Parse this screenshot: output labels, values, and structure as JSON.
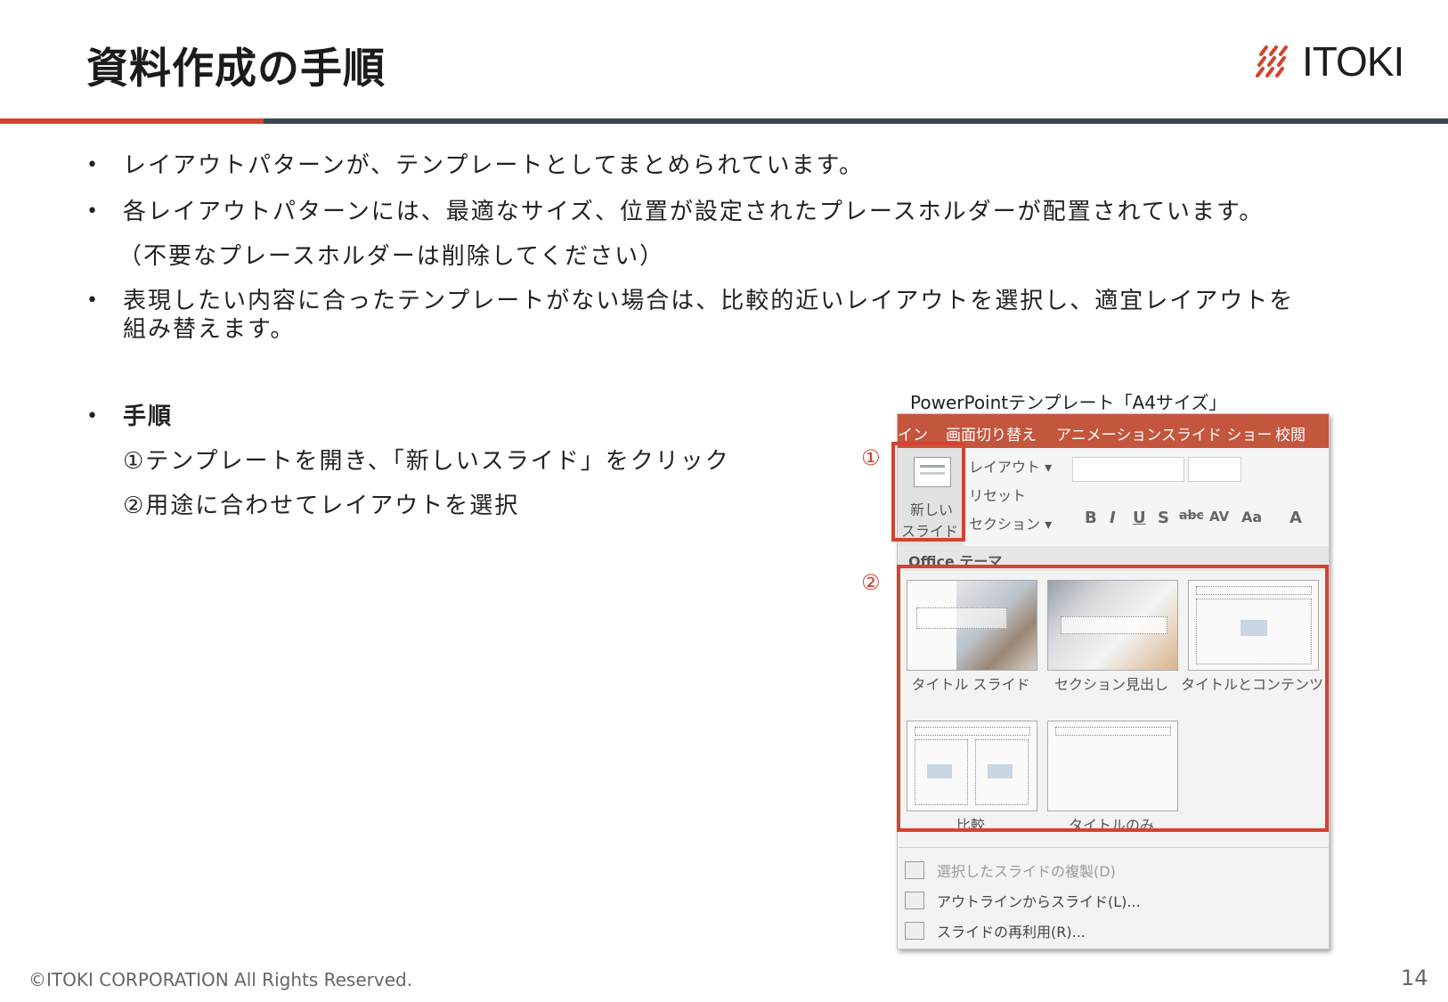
{
  "slide": {
    "title": "資料作成の手順",
    "logo_text": "ITOKI",
    "bullets": [
      "レイアウトパターンが、テンプレートとしてまとめられています。",
      "各レイアウトパターンには、最適なサイズ、位置が設定されたプレースホルダーが配置されています。",
      "表現したい内容に合ったテンプレートがない場合は、比較的近いレイアウトを選択し、適宜レイアウトを組み替えます。"
    ],
    "bullet2_note": "（不要なプレースホルダーは削除してください）",
    "procedure_heading": "手順",
    "steps": [
      "①テンプレートを開き、「新しいスライド」をクリック",
      "②用途に合わせてレイアウトを選択"
    ],
    "footer_copyright": "©ITOKI CORPORATION All Rights Reserved.",
    "page_number": "14"
  },
  "screenshot": {
    "caption": "PowerPointテンプレート「A4サイズ」",
    "markers": [
      "①",
      "②"
    ],
    "tabs": [
      "イン",
      "画面切り替え",
      "アニメーション",
      "スライド ショー",
      "校閲"
    ],
    "new_slide_label_1": "新しい",
    "new_slide_label_2": "スライド ▾",
    "layout_btn": "レイアウト ▾",
    "reset_btn": "リセット",
    "section_btn": "セクション ▾",
    "format_glyphs": [
      "B",
      "I",
      "U",
      "S",
      "abc",
      "AV",
      "Aa",
      "A"
    ],
    "theme_label": "Office テーマ",
    "layouts": [
      "タイトル スライド",
      "セクション見出し",
      "タイトルとコンテンツ",
      "比較",
      "タイトルのみ"
    ],
    "menu_items": [
      "選択したスライドの複製(D)",
      "アウトラインからスライド(L)...",
      "スライドの再利用(R)..."
    ]
  },
  "colors": {
    "accent_red": "#d4432f",
    "navy": "#3c4756",
    "ribbon_tab": "#c4563e"
  }
}
